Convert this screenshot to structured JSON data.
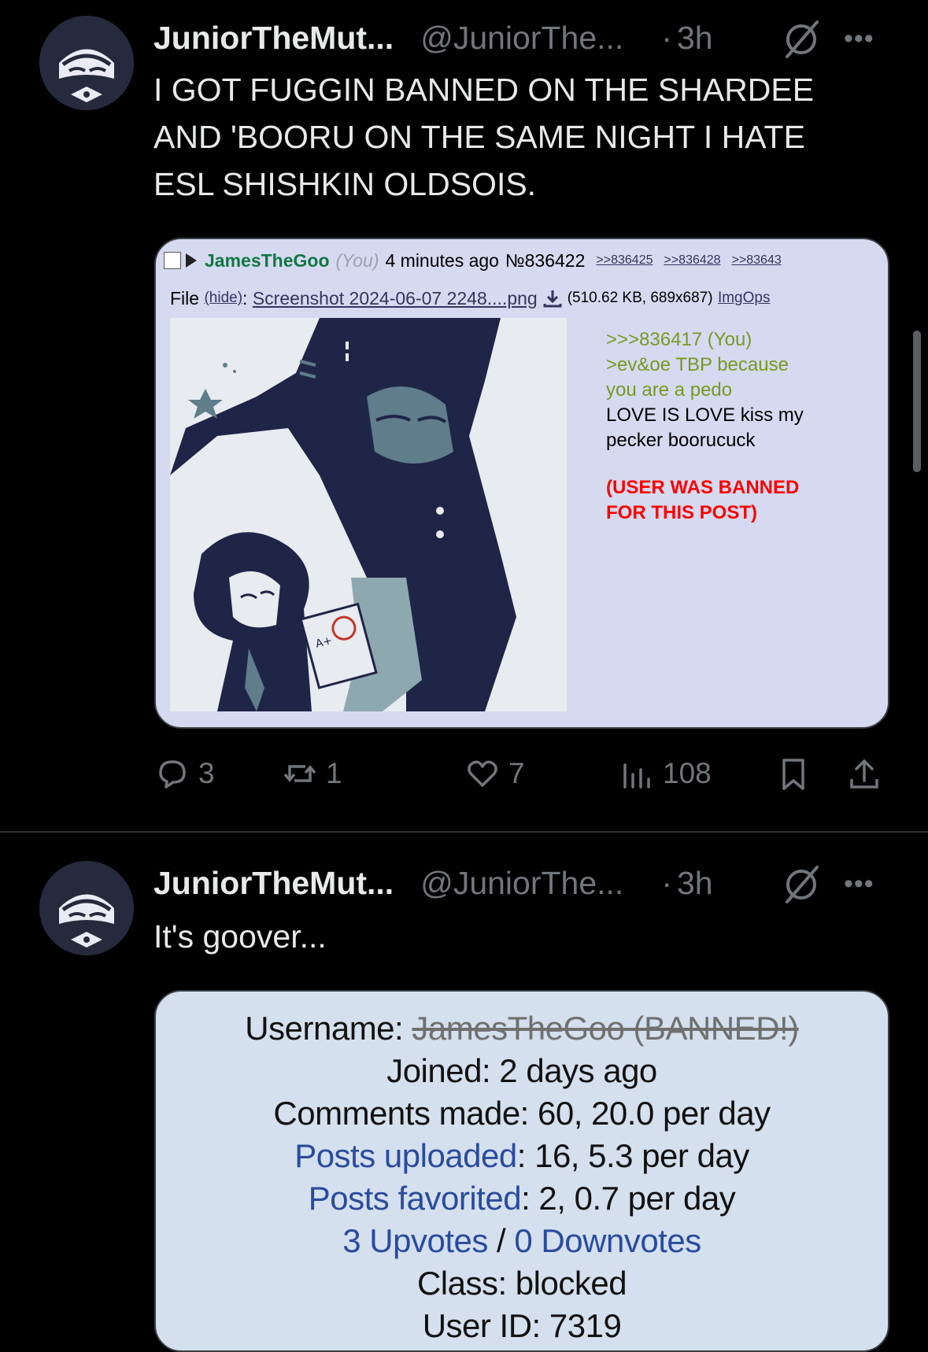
{
  "tweet1": {
    "display_name": "JuniorTheMut...",
    "handle": "@JuniorThe...",
    "separator": "·",
    "time": "3h",
    "more": "•••",
    "text_lines": [
      "I GOT FUGGIN BANNED ON THE SHARDEE",
      "AND 'BOORU ON THE SAME NIGHT I HATE",
      "ESL SHISHKIN OLDSOIS."
    ],
    "embedded_post": {
      "poster_name": "JamesTheGoo",
      "you_tag": "(You)",
      "date": "4 minutes ago",
      "post_number": "№836422",
      "quote_links": [
        ">>836425",
        ">>836428",
        ">>83643"
      ],
      "file_label": "File",
      "hide_link": "(hide)",
      "file_colon": ":",
      "filename": "Screenshot 2024-06-07 2248....png",
      "file_meta": "(510.62 KB, 689x687)",
      "imgops": "ImgOps",
      "body_lines": [
        ">>>836417 (You)",
        ">ev&oe TBP because",
        "you are a pedo",
        "LOVE IS LOVE kiss my",
        "pecker boorucuck"
      ],
      "ban_lines": [
        "(USER WAS BANNED",
        "FOR THIS POST)"
      ],
      "drawing_text": "A+"
    },
    "actions": {
      "replies": "3",
      "reposts": "1",
      "likes": "7",
      "views": "108"
    }
  },
  "tweet2": {
    "display_name": "JuniorTheMut...",
    "handle": "@JuniorThe...",
    "separator": "·",
    "time": "3h",
    "more": "•••",
    "text": "It's goover...",
    "profile": {
      "username_label": "Username: ",
      "username_value": "JamesTheGoo (BANNED!)",
      "joined": "Joined: 2 days ago",
      "comments": "Comments made: 60, 20.0 per day",
      "posts_uploaded_link": "Posts uploaded",
      "posts_uploaded_value": ": 16, 5.3 per day",
      "posts_favorited_link": "Posts favorited",
      "posts_favorited_value": ": 2, 0.7 per day",
      "upvotes_link": "3 Upvotes",
      "votes_sep": " / ",
      "downvotes_link": "0 Downvotes",
      "class_line": "Class: blocked",
      "userid_line": "User ID: 7319"
    }
  },
  "colors": {
    "background": "#000000",
    "muted": "#71767b",
    "card_4chan": "#d6daf0",
    "poster_green": "#117743",
    "ban_red": "#ff0000",
    "card_profile": "#d5e0ee",
    "link_blue": "#2a4b9e"
  },
  "icons": {
    "reply": "speech-bubble-icon",
    "repost": "repost-arrows-icon",
    "like": "heart-icon",
    "views": "bar-chart-icon",
    "bookmark": "bookmark-icon",
    "share": "share-upload-icon",
    "status": "circle-slash-icon"
  }
}
